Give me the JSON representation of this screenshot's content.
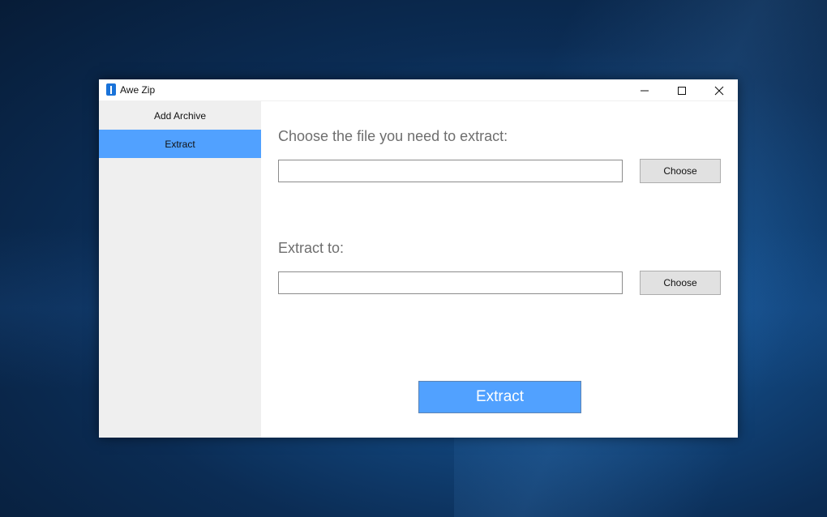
{
  "window": {
    "title": "Awe Zip",
    "accent_color": "#51a1ff"
  },
  "sidebar": {
    "items": [
      {
        "label": "Add Archive",
        "active": false
      },
      {
        "label": "Extract",
        "active": true
      }
    ]
  },
  "main": {
    "source_label": "Choose the file you need to extract:",
    "source_value": "",
    "source_button": "Choose",
    "dest_label": "Extract to:",
    "dest_value": "",
    "dest_button": "Choose",
    "action_button": "Extract"
  },
  "icons": {
    "app": "zip-file-icon",
    "minimize": "minimize-icon",
    "maximize": "maximize-icon",
    "close": "close-icon"
  }
}
